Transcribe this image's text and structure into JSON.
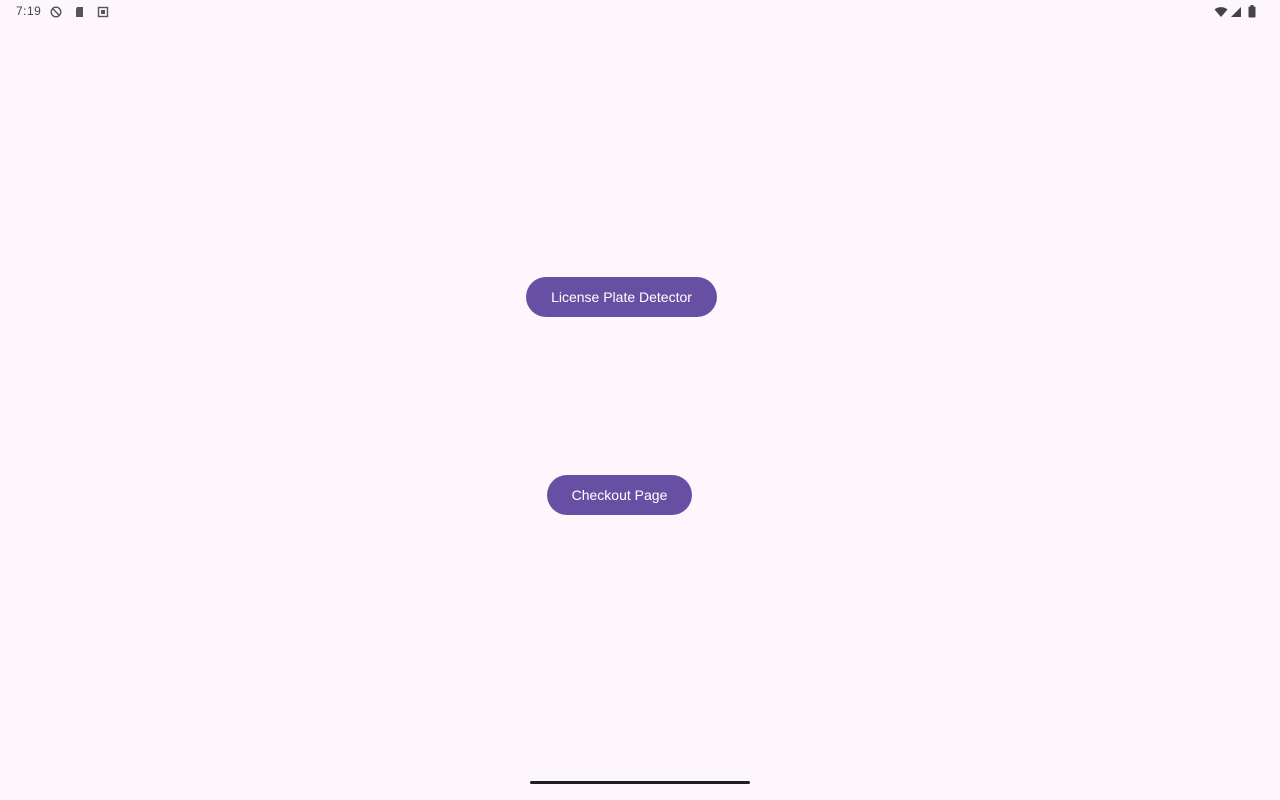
{
  "status_bar": {
    "time": "7:19",
    "left_icons": [
      "do-not-disturb-icon",
      "sd-card-icon",
      "screenshot-icon"
    ],
    "right_icons": [
      "wifi-icon",
      "signal-icon",
      "battery-icon"
    ]
  },
  "main": {
    "license_plate_button_label": "License Plate Detector",
    "checkout_button_label": "Checkout Page"
  },
  "colors": {
    "background": "#fdf7fd",
    "button": "#6750a4",
    "button_text": "#ffffff"
  }
}
